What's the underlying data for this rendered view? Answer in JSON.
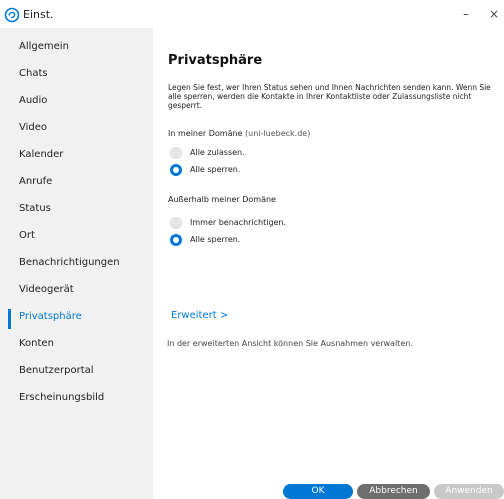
{
  "window": {
    "title": "Einst.",
    "minimize_symbol": "–",
    "close_symbol": "×"
  },
  "sidebar": {
    "items": [
      {
        "label": "Allgemein"
      },
      {
        "label": "Chats"
      },
      {
        "label": "Audio"
      },
      {
        "label": "Video"
      },
      {
        "label": "Kalender"
      },
      {
        "label": "Anrufe"
      },
      {
        "label": "Status"
      },
      {
        "label": "Ort"
      },
      {
        "label": "Benachrichtigungen"
      },
      {
        "label": "Videogerät"
      },
      {
        "label": "Privatsphäre",
        "active": true
      },
      {
        "label": "Konten"
      },
      {
        "label": "Benutzerportal"
      },
      {
        "label": "Erscheinungsbild"
      }
    ]
  },
  "main": {
    "heading": "Privatsphäre",
    "description": "Legen Sie fest, wer Ihren Status sehen und Ihnen Nachrichten senden kann. Wenn Sie alle sperren, werden die Kontakte in Ihrer Kontaktliste oder Zulassungsliste nicht gesperrt.",
    "in_domain": {
      "label": "In meiner Domäne",
      "domain": "(uni-luebeck.de)",
      "options": [
        {
          "label": "Alle zulassen.",
          "selected": false
        },
        {
          "label": "Alle sperren.",
          "selected": true
        }
      ]
    },
    "outside_domain": {
      "label": "Außerhalb meiner Domäne",
      "options": [
        {
          "label": "Immer benachrichtigen.",
          "selected": false
        },
        {
          "label": "Alle sperren.",
          "selected": true
        }
      ]
    },
    "advanced_link": "Erweitert >",
    "advanced_note": "In der erweiterten Ansicht können Sie Ausnahmen verwalten."
  },
  "buttons": {
    "ok": "OK",
    "cancel": "Abbrechen",
    "apply": "Anwenden"
  },
  "colors": {
    "accent": "#0078d4",
    "sidebar_bg": "#f1f1f1",
    "cancel_bg": "#6e6e6e",
    "apply_disabled_bg": "#c8c8c8"
  }
}
